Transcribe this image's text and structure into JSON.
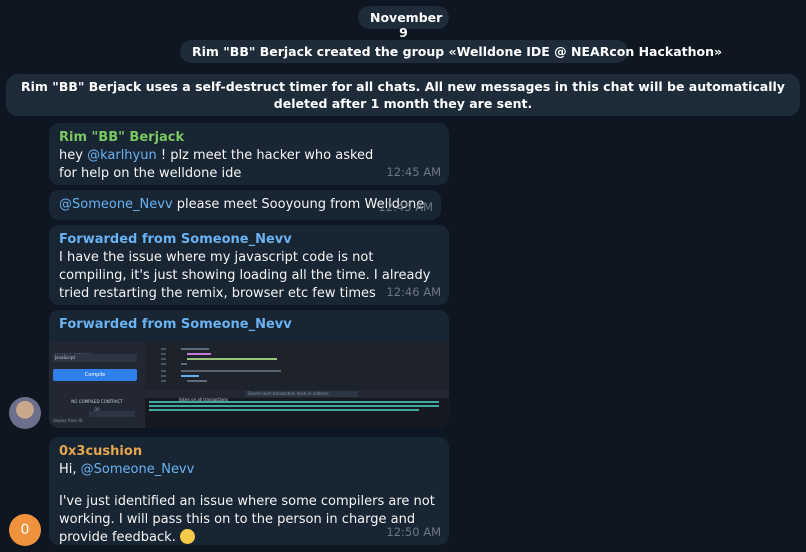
{
  "date_label": "November 9",
  "service_messages": [
    "Rim \"BB\" Berjack created the group «Welldone IDE @ NEARcon Hackathon»",
    "Rim \"BB\" Berjack uses a self-destruct timer for all chats. All new messages in this chat will be automatically deleted after 1 month they are sent."
  ],
  "messages": [
    {
      "sender": "Rim \"BB\" Berjack",
      "text_before": "hey ",
      "mention": "@karlhyun",
      "text_after": " ! plz meet the hacker who asked for help on the welldone ide",
      "time": "12:45 AM"
    },
    {
      "mention": "@Someone_Nevv",
      "text_after": " please meet Sooyoung from Welldone",
      "time": "12:45 AM"
    },
    {
      "forwarded": "Forwarded from Someone_Nevv",
      "text": "I have the issue where my javascript code is not compiling, it's just showing loading all the time. I already tried restarting the remix, browser etc few times",
      "time": "12:46 AM"
    },
    {
      "forwarded": "Forwarded from Someone_Nevv",
      "image_panel": {
        "compiler_label": "COMPILE OPTIONS",
        "compiler_value": "JavaScript",
        "compile_button": "Compile",
        "no_contract": "NO COMPILED CONTRACT",
        "or": "OR",
        "deploy_label": "deploy from ID",
        "terminal_label": "listen on all transactions",
        "terminal_search": "Search with transaction hash or address"
      }
    },
    {
      "sender": "0x3cushion",
      "greeting": "Hi, ",
      "mention": "@Someone_Nevv",
      "text": "I've just identified an issue where some compilers are not working. I will pass this on to the person in charge and provide feedback.",
      "emoji": "🙂",
      "time": "12:50 AM",
      "avatar_letter": "0"
    }
  ],
  "colors": {
    "background": "#0e1621",
    "bubble": "#182533",
    "sender_green": "#7bc862",
    "sender_orange": "#e5a64e",
    "link": "#6ab2f2"
  }
}
